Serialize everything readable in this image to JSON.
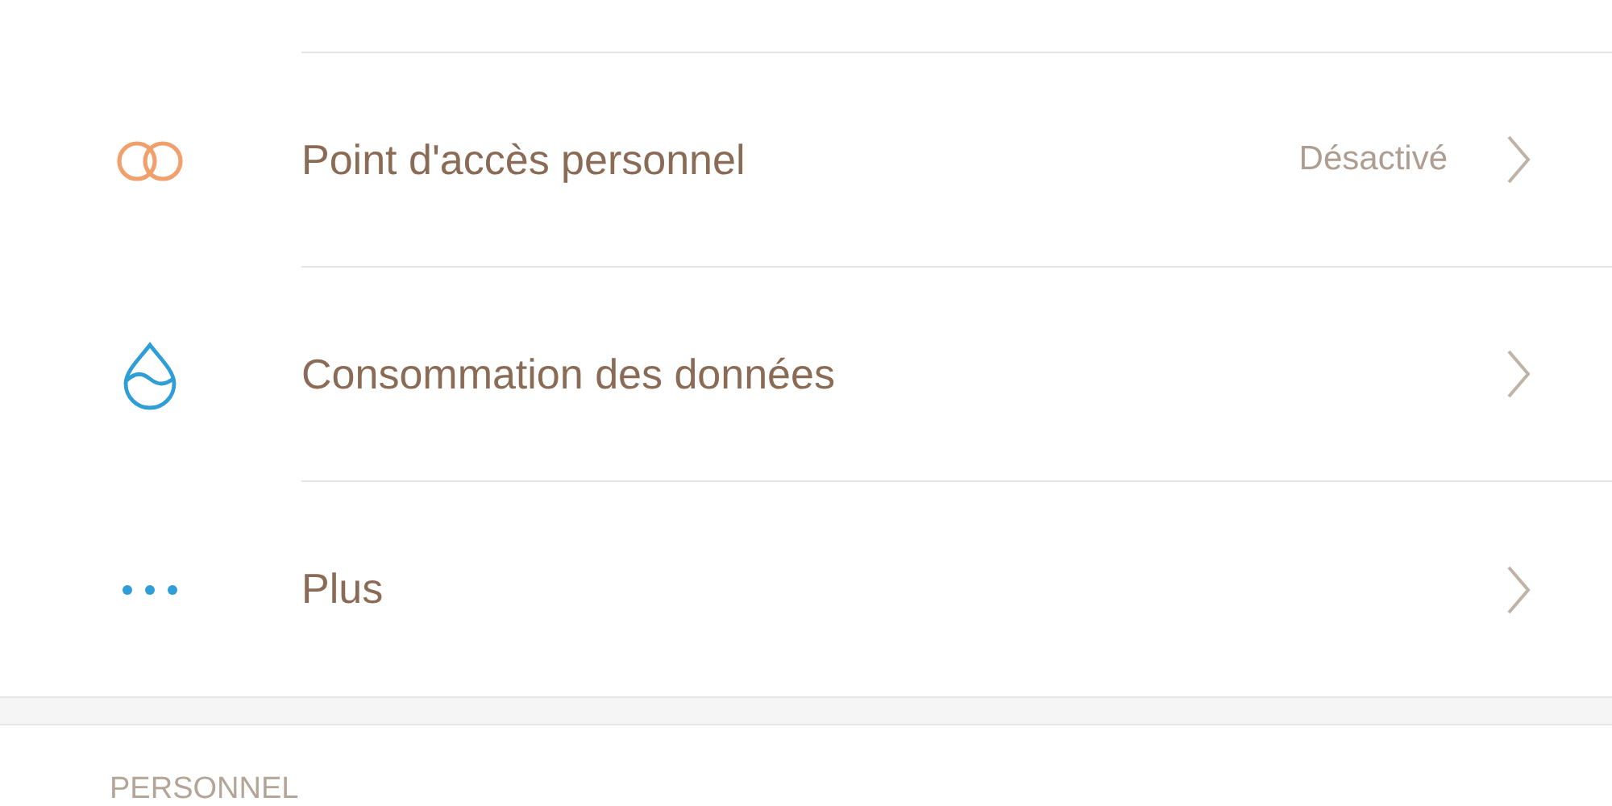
{
  "settings_items": [
    {
      "label": "Point d'accès personnel",
      "value": "Désactivé"
    },
    {
      "label": "Consommation des données"
    },
    {
      "label": "Plus"
    }
  ],
  "section_header": "PERSONNEL"
}
